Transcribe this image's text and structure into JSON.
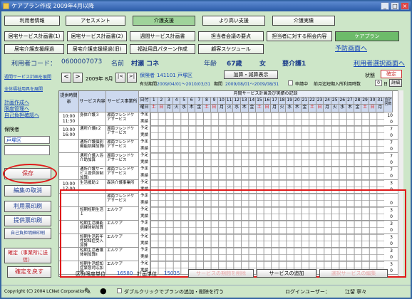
{
  "window": {
    "title": "ケアプラン作成 2009年4月以降",
    "min": "_",
    "max": "□",
    "close": "×"
  },
  "menu1": [
    "利用者情報",
    "アセスメント",
    "介護支援",
    "より高い支援",
    "介護実績"
  ],
  "menu2": [
    "居宅サービス計画書(1)",
    "居宅サービス計画書(2)",
    "週間サービス計画書",
    "担当者会議の要点",
    "担当者に対する照会内容",
    "ケアプラン"
  ],
  "menu3": [
    "居宅介護支援経過",
    "居宅介護支援経過(旧)",
    "福祉用具パターン作成",
    "顧客スケジュール"
  ],
  "menu3_link": "予防画面へ",
  "patient": {
    "code_label": "利用者コード：",
    "code": "0600007073",
    "name_label": "名前",
    "name": "村瀬 コネ",
    "age_label": "年齢",
    "age": "67歳",
    "sex": "女",
    "care_level": "要介護1",
    "switch_link": "利用者選択画面へ"
  },
  "sidebar": {
    "links": [
      "週間サービス計画を展開",
      "全体福祉用具を展開",
      "計画作成へ",
      "限度管理へ",
      "自己負担確認へ"
    ],
    "insurer_label": "保険者",
    "insurer_value": "戸塚区",
    "buttons": [
      "保存",
      "編集の取消",
      "利用票印刷",
      "提供票印刷",
      "自己負担明細印刷",
      "確定（事業所に送信）",
      "確定を戻す"
    ]
  },
  "controls": {
    "prev": "<",
    "next": ">",
    "month": "2009年 8月",
    "prev_page": "|<",
    "next_page": ">|",
    "insurer_no_label": "保険者",
    "insurer_no": "141101 戸塚区",
    "add_reduce_btn": "加算・減算表示",
    "state_label": "状態",
    "state_value": "確定",
    "validity_label": "有効期間",
    "validity": "2009/04/01〜2010/03/31",
    "period_label": "期間",
    "period": "2009/08/01〜2009/08/31",
    "apply_label": "申請中",
    "prev_month_label": "前月迄短期入所利用時数",
    "prev_month_value": "0",
    "prev_month_unit": "日",
    "detail_btn": "詳細"
  },
  "grid": {
    "title": "月間サービス計画及び実績の記録",
    "col_time": "提供時間帯",
    "col_svc": "サービス内容",
    "col_ofc": "サービス事業所",
    "row_day": "日付",
    "row_dow": "曜日",
    "days": [
      "1",
      "2",
      "3",
      "4",
      "5",
      "6",
      "7",
      "8",
      "9",
      "10",
      "11",
      "12",
      "13",
      "14",
      "15",
      "16",
      "17",
      "18",
      "19",
      "20",
      "21",
      "22",
      "23",
      "24",
      "25",
      "26",
      "27",
      "28",
      "29",
      "30",
      "31"
    ],
    "dows": [
      "土",
      "日",
      "月",
      "火",
      "水",
      "木",
      "金",
      "土",
      "日",
      "月",
      "火",
      "水",
      "木",
      "金",
      "土",
      "日",
      "月",
      "火",
      "水",
      "木",
      "金",
      "土",
      "日",
      "月",
      "火",
      "水",
      "木",
      "金",
      "土",
      "日",
      "月"
    ],
    "total": "合計回数",
    "plan": "予定",
    "actual": "実績",
    "rows": [
      {
        "time": "10:00\n11:30",
        "svc": "身体介護３",
        "ofc": "湘南フレンドケアサービス",
        "plan_total": "10",
        "act_total": "0"
      },
      {
        "time": "10:00\n16:00",
        "svc": "通所介護Ⅱ２",
        "ofc": "湘南フレンドケアサービス",
        "plan_total": "7",
        "act_total": "0"
      },
      {
        "time": "",
        "svc": "通所介護個別機能訓練加算Ⅰ",
        "ofc": "湘南フレンドケアサービス",
        "plan_total": "7",
        "act_total": "0"
      },
      {
        "time": "",
        "svc": "通所介護入浴介助加算",
        "ofc": "湘南フレンドケアサービス",
        "plan_total": "7",
        "act_total": "0"
      },
      {
        "time": "",
        "svc": "通所介護サービス提供体制加算Ⅰ",
        "ofc": "湘南フレンドケアサービス",
        "plan_total": "7",
        "act_total": "0"
      },
      {
        "time": "10:00\n17:00",
        "svc": "生活援助２",
        "ofc": "森浜介護事業所",
        "plan_total": "3",
        "act_total": "0"
      },
      {
        "time": "",
        "svc": "",
        "ofc": "湘南フレンドケアサービス",
        "plan_total": "",
        "act_total": "0"
      },
      {
        "time": "",
        "svc": "短期短期生活１",
        "ofc": "エルケア",
        "plan_total": "3",
        "act_total": "0"
      },
      {
        "time": "",
        "svc": "短期生活機能訓練体制加算",
        "ofc": "エルケア",
        "plan_total": "3",
        "act_total": "0"
      },
      {
        "time": "",
        "svc": "短期生活若年性認知症受入加算",
        "ofc": "エルケア",
        "plan_total": "3",
        "act_total": "0"
      },
      {
        "time": "",
        "svc": "短期生活看護体制加算Ⅱ",
        "ofc": "エルケア",
        "plan_total": "3",
        "act_total": "0"
      },
      {
        "time": "",
        "svc": "短期生活認知症緊急対応加算",
        "ofc": "エルケア",
        "plan_total": "3",
        "act_total": "0"
      }
    ],
    "care_level_row": "要介護1"
  },
  "bottom": {
    "limit_label": "区分限度単位",
    "limit_value": "16580",
    "plan_label": "計画単位",
    "plan_value": "15035",
    "btn1": "サービスの期間を削除",
    "btn2": "サービスの追加",
    "btn3": "選択サービスの編集"
  },
  "status": {
    "copyright": "Copyright (C) 2004 LCNet Corporation",
    "dblclick": "ダブルクリックでプランの追加・削除を行う",
    "login_label": "ログインユーザー：",
    "login_user": "江留 寧々"
  }
}
